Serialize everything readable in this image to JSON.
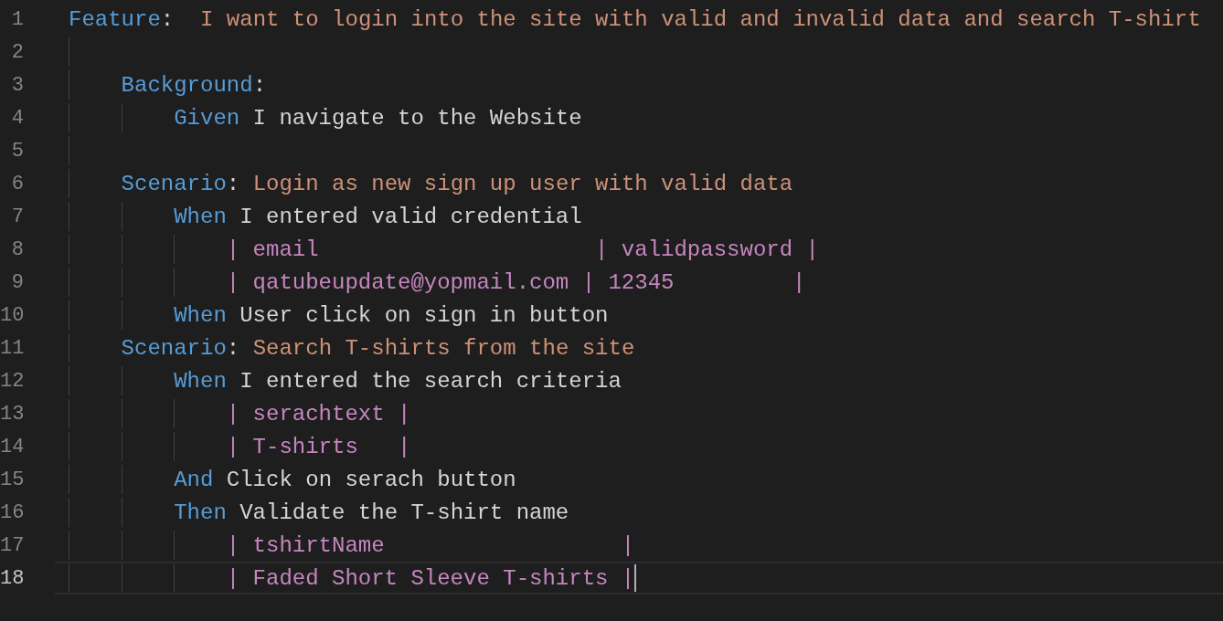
{
  "editor": {
    "lines": [
      {
        "number": "1",
        "tokens": [
          {
            "kind": "keyword",
            "text": "Feature"
          },
          {
            "kind": "plain",
            "text": ":  "
          },
          {
            "kind": "title",
            "text": "I want to login into the site with valid and invalid data and search T-shirt"
          }
        ],
        "current": false,
        "children": [
          {
            "number": "2",
            "current": false
          },
          {
            "number": "3",
            "tokens": [
              {
                "kind": "keyword",
                "text": "Background"
              },
              {
                "kind": "plain",
                "text": ":"
              }
            ],
            "current": false,
            "children": [
              {
                "number": "4",
                "tokens": [
                  {
                    "kind": "keyword",
                    "text": "Given"
                  },
                  {
                    "kind": "plain",
                    "text": " I navigate to the Website"
                  }
                ],
                "current": false
              }
            ]
          },
          {
            "number": "5",
            "current": false
          },
          {
            "number": "6",
            "tokens": [
              {
                "kind": "keyword",
                "text": "Scenario"
              },
              {
                "kind": "plain",
                "text": ": "
              },
              {
                "kind": "title",
                "text": "Login as new sign up user with valid data"
              }
            ],
            "current": false,
            "children": [
              {
                "number": "7",
                "tokens": [
                  {
                    "kind": "keyword",
                    "text": "When"
                  },
                  {
                    "kind": "plain",
                    "text": " I entered valid credential"
                  }
                ],
                "current": false,
                "children": [
                  {
                    "number": "8",
                    "tokens": [
                      {
                        "kind": "table",
                        "text": "| email                     | validpassword |"
                      }
                    ],
                    "current": false
                  },
                  {
                    "number": "9",
                    "tokens": [
                      {
                        "kind": "table",
                        "text": "| qatubeupdate@yopmail.com | 12345         |"
                      }
                    ],
                    "current": false
                  }
                ]
              },
              {
                "number": "10",
                "tokens": [
                  {
                    "kind": "keyword",
                    "text": "When"
                  },
                  {
                    "kind": "plain",
                    "text": " User click on sign in button"
                  }
                ],
                "current": false
              }
            ]
          },
          {
            "number": "11",
            "tokens": [
              {
                "kind": "keyword",
                "text": "Scenario"
              },
              {
                "kind": "plain",
                "text": ": "
              },
              {
                "kind": "title",
                "text": "Search T-shirts from the site"
              }
            ],
            "current": false,
            "children": [
              {
                "number": "12",
                "tokens": [
                  {
                    "kind": "keyword",
                    "text": "When"
                  },
                  {
                    "kind": "plain",
                    "text": " I entered the search criteria"
                  }
                ],
                "current": false,
                "children": [
                  {
                    "number": "13",
                    "tokens": [
                      {
                        "kind": "table",
                        "text": "| serachtext |"
                      }
                    ],
                    "current": false
                  },
                  {
                    "number": "14",
                    "tokens": [
                      {
                        "kind": "table",
                        "text": "| T-shirts   |"
                      }
                    ],
                    "current": false
                  }
                ]
              },
              {
                "number": "15",
                "tokens": [
                  {
                    "kind": "keyword",
                    "text": "And"
                  },
                  {
                    "kind": "plain",
                    "text": " Click on serach button"
                  }
                ],
                "current": false
              },
              {
                "number": "16",
                "tokens": [
                  {
                    "kind": "keyword",
                    "text": "Then"
                  },
                  {
                    "kind": "plain",
                    "text": " Validate the T-shirt name"
                  }
                ],
                "current": false,
                "children": [
                  {
                    "number": "17",
                    "tokens": [
                      {
                        "kind": "table",
                        "text": "| tshirtName                  |"
                      }
                    ],
                    "current": false
                  },
                  {
                    "number": "18",
                    "tokens": [
                      {
                        "kind": "table",
                        "text": "| Faded Short Sleeve T-shirts |"
                      }
                    ],
                    "current": true
                  }
                ]
              }
            ]
          }
        ]
      }
    ]
  }
}
